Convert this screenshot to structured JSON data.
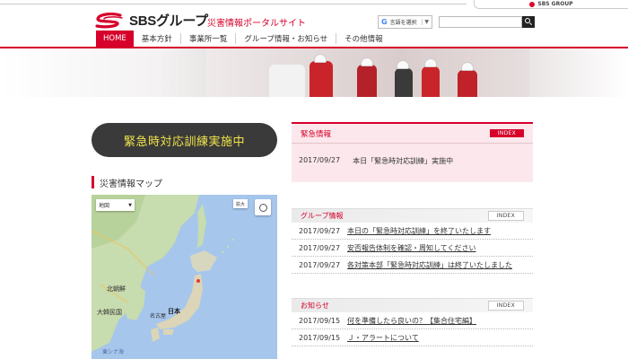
{
  "header": {
    "group_tag": "SBS GROUP",
    "logo_text": "SBSグループ",
    "site_title": "災害情報ポータルサイト",
    "language_select": "言語を選択",
    "search_placeholder": ""
  },
  "nav": {
    "items": [
      {
        "label": "HOME",
        "active": true
      },
      {
        "label": "基本方針"
      },
      {
        "label": "事業所一覧"
      },
      {
        "label": "グループ情報・お知らせ"
      },
      {
        "label": "その他情報"
      }
    ]
  },
  "drill_banner": "緊急時対応訓練実施中",
  "map": {
    "title": "災害情報マップ",
    "type_label": "地図",
    "fullscreen_label": "拡大",
    "labels": {
      "north_korea": "北朝鮮",
      "south_korea": "大韓民国",
      "japan": "日本",
      "nagoya": "名古屋",
      "east_china_sea": "東シナ海"
    }
  },
  "emergency": {
    "title": "緊急情報",
    "index_label": "INDEX",
    "items": [
      {
        "date": "2017/09/27",
        "text": "本日「緊急時対応訓練」実施中"
      }
    ]
  },
  "group_info": {
    "title": "グループ情報",
    "index_label": "INDEX",
    "items": [
      {
        "date": "2017/09/27",
        "text": "本日の「緊急時対応訓練」を終了いたします"
      },
      {
        "date": "2017/09/27",
        "text": "安否報告体制を確認・周知してください"
      },
      {
        "date": "2017/09/27",
        "text": "各対策本部「緊急時対応訓練」は終了いたしました"
      }
    ]
  },
  "notices": {
    "title": "お知らせ",
    "index_label": "INDEX",
    "items": [
      {
        "date": "2017/09/15",
        "text": "何を準備したら良いの？【集合住宅編】"
      },
      {
        "date": "2017/09/15",
        "text": "Ｊ・アラートについて"
      }
    ]
  },
  "colors": {
    "brand_red": "#d6002a",
    "banner_bg": "#3a3a3a",
    "banner_text": "#f0e44a",
    "emergency_bg": "#fce8ec"
  }
}
